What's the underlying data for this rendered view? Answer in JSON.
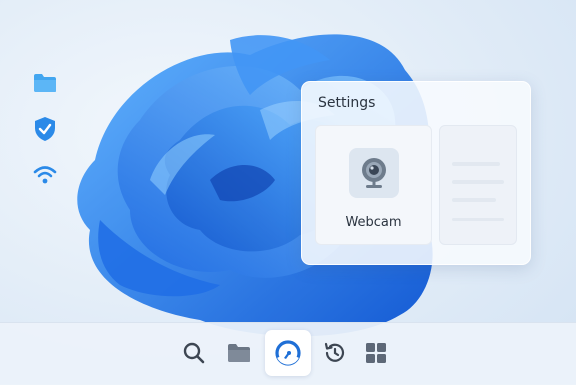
{
  "desktop": {
    "side_icons": [
      {
        "name": "folder-icon",
        "color": "#3aa0ef"
      },
      {
        "name": "shield-check-icon",
        "color": "#2b8ae8"
      },
      {
        "name": "wifi-icon",
        "color": "#2b8ae8"
      }
    ]
  },
  "settings": {
    "title": "Settings",
    "cards": [
      {
        "label": "Webcam",
        "icon": "webcam-icon"
      }
    ]
  },
  "taskbar": {
    "items": [
      {
        "name": "search-icon",
        "active": false
      },
      {
        "name": "folder-icon",
        "active": false
      },
      {
        "name": "edge-icon",
        "active": true
      },
      {
        "name": "history-icon",
        "active": false
      },
      {
        "name": "windows-icon",
        "active": false
      }
    ]
  },
  "colors": {
    "accent": "#1f6fd6",
    "wallpaper_light": "#eaf2fa"
  }
}
